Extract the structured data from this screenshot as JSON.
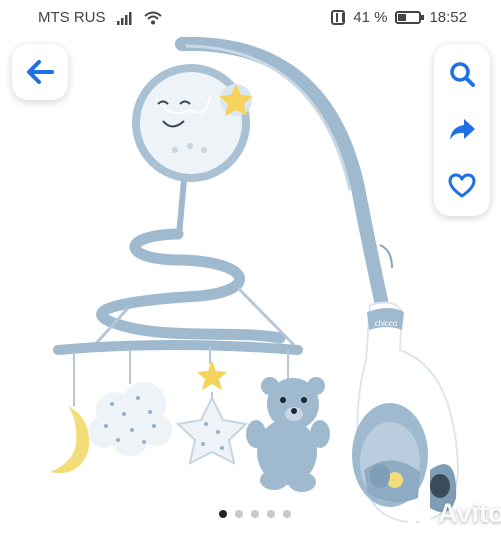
{
  "status_bar": {
    "carrier": "MTS RUS",
    "battery_percent": "41 %",
    "battery_level": 0.41,
    "time": "18:52",
    "icons": [
      "signal-icon",
      "wifi-icon",
      "nfc-icon",
      "battery-icon"
    ]
  },
  "navigation": {
    "back_icon": "arrow-left-icon",
    "actions": [
      "search-icon",
      "share-icon",
      "heart-icon"
    ]
  },
  "gallery": {
    "image_count": 5,
    "current_index": 1,
    "mobile_brand": "chicco",
    "watermark": "Avito"
  },
  "colors": {
    "accent": "#1f6fe5",
    "mobile_blue": "#9fb9ce",
    "mobile_dark": "#7f9db6",
    "star_yellow": "#f5d35a",
    "moon_yellow": "#f3dd78"
  }
}
